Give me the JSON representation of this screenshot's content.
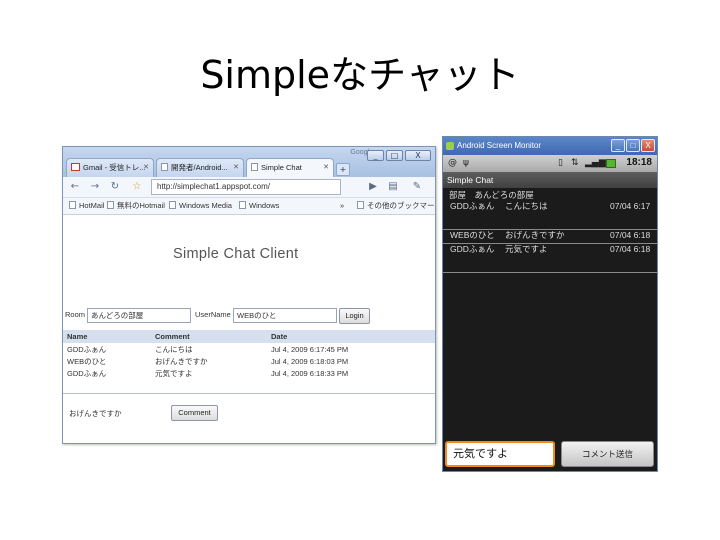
{
  "slide": {
    "title": "Simpleなチャット"
  },
  "browser": {
    "titlebar_text": "Google",
    "window_buttons": [
      "_",
      "□",
      "X"
    ],
    "tabs": [
      {
        "label": "Gmail - 受信トレ..."
      },
      {
        "label": "開発者/Android..."
      },
      {
        "label": "Simple Chat"
      }
    ],
    "new_tab": "+",
    "address": "http://simplechat1.appspot.com/",
    "bookmarks": [
      "HotMail",
      "無料のHotmail",
      "Windows Media",
      "Windows",
      "その他のブックマーク"
    ],
    "page": {
      "heading": "Simple Chat Client",
      "room_label": "Room",
      "room_value": "あんどろの部屋",
      "user_label": "UserName",
      "user_value": "WEBのひと",
      "login_button": "Login",
      "table": {
        "headers": [
          "Name",
          "Comment",
          "Date"
        ],
        "rows": [
          [
            "GDDふぁん",
            "こんにちは",
            "Jul 4, 2009 6:17:45 PM"
          ],
          [
            "WEBのひと",
            "おげんきですか",
            "Jul 4, 2009 6:18:03 PM"
          ],
          [
            "GDDふぁん",
            "元気ですよ",
            "Jul 4, 2009 6:18:33 PM"
          ]
        ]
      },
      "comment_value": "おげんきですか",
      "comment_button": "Comment"
    }
  },
  "android": {
    "window_title": "Android Screen Monitor",
    "window_buttons": [
      "_",
      "□",
      "X"
    ],
    "status_time": "18:18",
    "app_title": "Simple Chat",
    "room": "部屋　あんどろの部屋",
    "messages": [
      {
        "name": "GDDふぁん",
        "text": "こんにちは",
        "date": "07/04 6:17"
      },
      {
        "name": "WEBのひと",
        "text": "おげんきですか",
        "date": "07/04 6:18"
      },
      {
        "name": "GDDふぁん",
        "text": "元気ですよ",
        "date": "07/04 6:18"
      }
    ],
    "input_value": "元気ですよ",
    "send_button": "コメント送信"
  }
}
